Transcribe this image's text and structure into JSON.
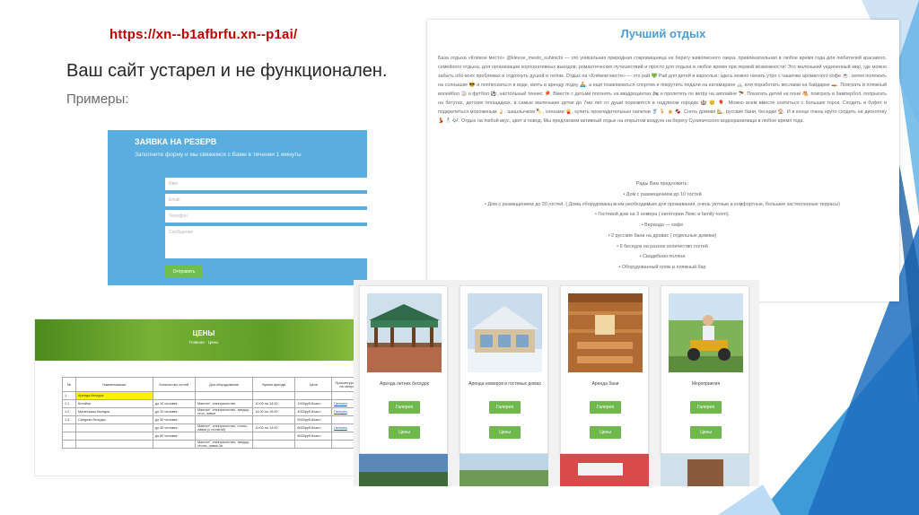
{
  "slide": {
    "url": "https://xn--b1afbrfu.xn--p1ai/",
    "headline": "Ваш сайт устарел и не функционален.",
    "subheading": "Примеры:"
  },
  "form": {
    "title": "ЗАЯВКА НА РЕЗЕРВ",
    "subtitle": "Заполните форму и мы свяжемся с Вами в течении 1 минуты",
    "name_placeholder": "Имя",
    "email_placeholder": "Email",
    "phone_placeholder": "Телефон",
    "message_placeholder": "Сообщение",
    "submit_label": "Отправить"
  },
  "prices": {
    "title": "ЦЕНЫ",
    "breadcrumb": "Главная · Цены",
    "headers": [
      "№",
      "Наименование",
      "Количество гостей",
      "Доп.оборудование",
      "Время аренды",
      "Цена",
      "Просмотр(ссылка на галерею)"
    ],
    "section": {
      "num": "1",
      "name": "Аренда беседок"
    },
    "rows": [
      [
        "1.1",
        "Котэйон",
        "до 10 человек",
        "Мангал*, электричество",
        "10:00 по 14:00",
        "1000руб.8часл",
        "Галерея"
      ],
      [
        "1.2",
        "Маленькая беседка",
        "до 20 человек",
        "Мангал*, электричество, тандыр, стол, лавки",
        "14:00 по 19:00",
        "4000руб.8часл",
        "Галерея"
      ],
      [
        "1.3",
        "Средняя беседка",
        "до 30 человек",
        "",
        "",
        "5000руб.8часл",
        ""
      ],
      [
        "",
        "",
        "до 40 человек",
        "Мангал*, электричество, столы, лавки (с оплатой)",
        "10:00 по 14:00",
        "6000руб.8часл",
        "Галерея"
      ],
      [
        "",
        "",
        "до 80 человек",
        "",
        "",
        "8000руб.8часл",
        ""
      ],
      [
        "",
        "",
        "",
        "Мангал*, электричество, тандыр, столы, лавки 3а",
        "",
        "",
        ""
      ]
    ]
  },
  "rest": {
    "title": "Лучший отдых",
    "paragraph": "База отдыха «Клёвое место» @klevoe_mesto_suhinichi — это уникальная природная сокровищница на берегу живописного озера, привлекательная в любое время года для любителей красивого, семейного отдыха, для организации корпоративных выездов, романтических путешествий и просто для отдыха в любое время при первой возможности! Это маленький уединенный мир, где можно забыть обо всех проблемах и отдохнуть душой и телом. Отдых на «Клёвом месте» — это рай 💚 Рай для детей и взрослых: здесь можно начать утро с чашечки ароматного кофе ☕, затем полежать на солнышке 😎 и поплескаться в воде, взять в аренду лодку 🚣, а еще позаниматься спортом и покрутить педали на катамаране 🚲 или поработать веслами на байдарке 🛶. Поиграть в пляжный волейбол 🏐 и футбол ⚽, настольный теннис 🏓. Вместе с детьми погонять на квадроциклах 🏍 и пролететь по ветру на зиплайне 🪂. Покатать детей на пони 🐴, поиграть в бампербол, попрыгать на батутах, детских площадках, в самые маленькие детки до 7ми лет от души порезвятся в надувном городке 🏰 😊 🎈. Можно всем вместе скатиться с больших горок. Сходить в буфет и подкрепиться мороженым 🍦, шашлычком 🍢, снеками 🍟, купить прохладительные напитки 🥤 🍹 🍺 🍫. Снять домики 🏡, русские бани, беседки 🏠. И в конце очень круто сходить на дискотеку 💃 🕺 🎶. Отдых на любой вкус, цвет и повод. Мы предлагаем активный отдых на открытом воздухе на берегу Сухиничского водохранилища в любое время года.",
    "list_title": "Рады Вам предложить:",
    "list": [
      "• Дом с размещением до 10 гостей",
      "• Дом с размещением до 20 гостей. ( Дома оборудованы всем необходимым для проживания, очень уютные и комфортные, большие застекленные террасы)",
      "• Гостевой дом на 3 номера ( категории Люкс и family room).",
      "• Веранда — кафе",
      "• 2 русские бани на дровах ( отдельные домики)",
      "• 6 беседок на разное количество гостей",
      "• Свадебная поляна",
      "• Оборудованный пляж и пляжный бар"
    ]
  },
  "cards": {
    "gallery_label": "Галерея",
    "prices_label": "Цены",
    "items": [
      {
        "caption": "Аренда летних беседок"
      },
      {
        "caption": "Аренда номеров в гостевых домах"
      },
      {
        "caption": "Аренда бани"
      },
      {
        "caption": "Мероприятия"
      }
    ]
  },
  "colors": {
    "url": "#c00000",
    "form_bg": "#5aaedf",
    "button_green": "#6fb94c",
    "title_blue": "#4f9dd4",
    "deco_blue": "#1f6fbf"
  }
}
